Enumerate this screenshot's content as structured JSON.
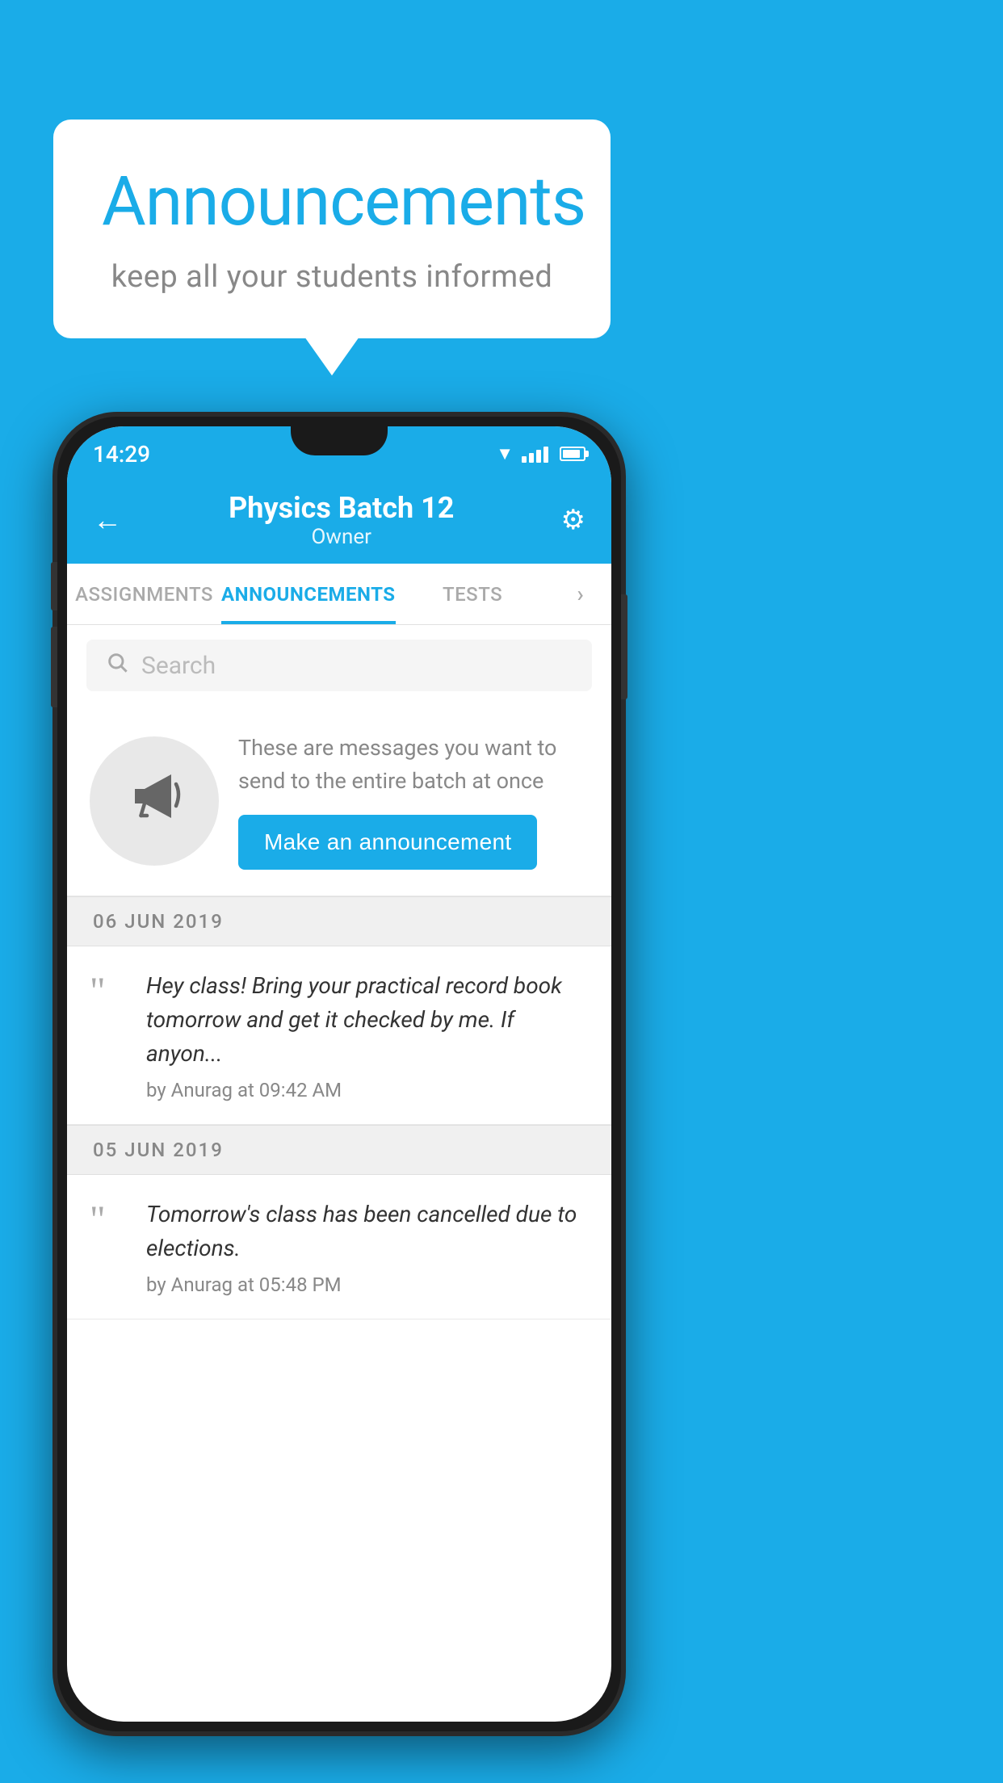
{
  "bubble": {
    "title": "Announcements",
    "subtitle": "keep all your students informed"
  },
  "status_bar": {
    "time": "14:29"
  },
  "header": {
    "title": "Physics Batch 12",
    "subtitle": "Owner",
    "back_label": "←",
    "gear_label": "⚙"
  },
  "tabs": [
    {
      "label": "ASSIGNMENTS",
      "active": false
    },
    {
      "label": "ANNOUNCEMENTS",
      "active": true
    },
    {
      "label": "TESTS",
      "active": false
    },
    {
      "label": "...",
      "active": false
    }
  ],
  "search": {
    "placeholder": "Search"
  },
  "announcement_prompt": {
    "description": "These are messages you want to send to the entire batch at once",
    "button_label": "Make an announcement"
  },
  "announcements": [
    {
      "date": "06  JUN  2019",
      "text": "Hey class! Bring your practical record book tomorrow and get it checked by me. If anyon...",
      "meta": "by Anurag at 09:42 AM"
    },
    {
      "date": "05  JUN  2019",
      "text": "Tomorrow's class has been cancelled due to elections.",
      "meta": "by Anurag at 05:48 PM"
    }
  ]
}
